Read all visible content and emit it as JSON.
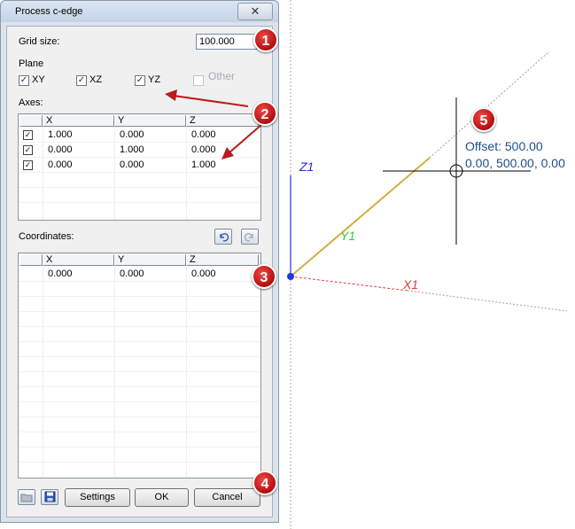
{
  "dialog": {
    "title": "Process c-edge",
    "close_icon": "close-icon",
    "grid_size_label": "Grid size:",
    "grid_size_value": "100.000",
    "plane_label": "Plane",
    "planes": [
      {
        "label": "XY",
        "checked": true,
        "enabled": true
      },
      {
        "label": "XZ",
        "checked": true,
        "enabled": true
      },
      {
        "label": "YZ",
        "checked": true,
        "enabled": true
      },
      {
        "label": "Other",
        "checked": false,
        "enabled": false
      }
    ],
    "axes_label": "Axes:",
    "axes_table": {
      "headers": [
        "X",
        "Y",
        "Z"
      ],
      "rows": [
        {
          "checked": true,
          "x": "1.000",
          "y": "0.000",
          "z": "0.000"
        },
        {
          "checked": true,
          "x": "0.000",
          "y": "1.000",
          "z": "0.000"
        },
        {
          "checked": true,
          "x": "0.000",
          "y": "0.000",
          "z": "1.000"
        }
      ]
    },
    "coordinates_label": "Coordinates:",
    "coord_icons": [
      "undo-icon",
      "redo-icon"
    ],
    "coordinates_table": {
      "headers": [
        "X",
        "Y",
        "Z"
      ],
      "rows": [
        {
          "x": "0.000",
          "y": "0.000",
          "z": "0.000"
        }
      ]
    },
    "footer": {
      "open_icon": "folder-icon",
      "save_icon": "save-icon",
      "settings_label": "Settings",
      "ok_label": "OK",
      "cancel_label": "Cancel"
    }
  },
  "viewport": {
    "axis_labels": {
      "z": "Z1",
      "y": "Y1",
      "x": "X1"
    },
    "offset_line1": "Offset: 500.00",
    "offset_line2": "0.00, 500.00, 0.00",
    "colors": {
      "z_axis": "#2b2bd6",
      "y_axis": "#33cc33",
      "x_axis": "#d94040",
      "edge": "#e8a33a",
      "offset_text": "#1f4e8c"
    }
  },
  "callouts": [
    "1",
    "2",
    "3",
    "4",
    "5"
  ]
}
